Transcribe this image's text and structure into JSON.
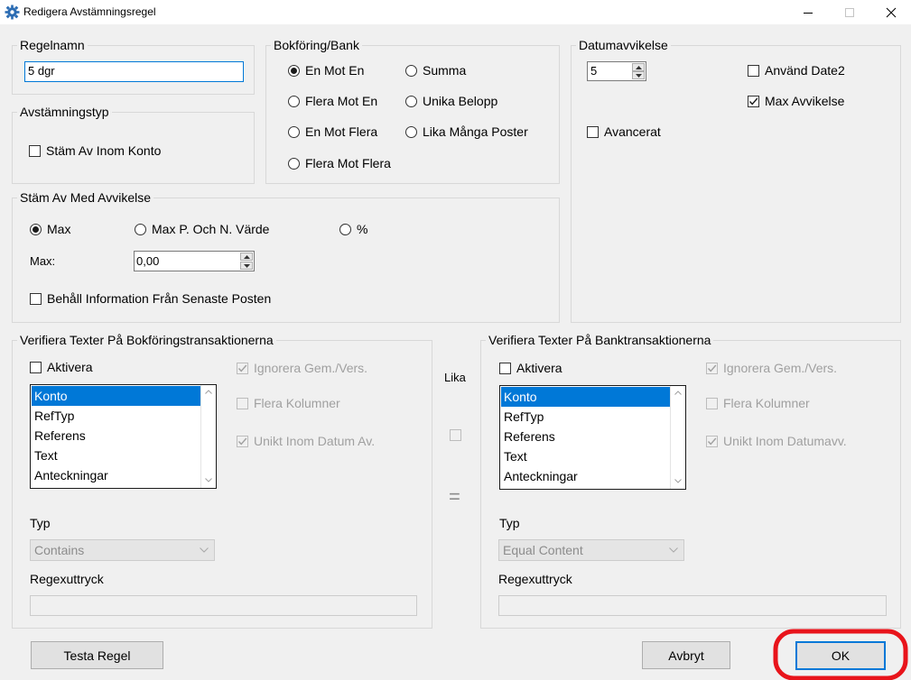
{
  "window": {
    "title": "Redigera Avstämningsregel",
    "icon": "gear-icon",
    "controls": [
      "minimize-icon",
      "maximize-icon",
      "close-icon"
    ]
  },
  "regelnamn": {
    "label": "Regelnamn",
    "value": "5 dgr"
  },
  "avstamningstyp": {
    "label": "Avstämningstyp",
    "checkbox_label": "Stäm Av Inom Konto",
    "checked": false
  },
  "bokforing_bank": {
    "label": "Bokföring/Bank",
    "options": [
      "En Mot En",
      "Summa",
      "Flera Mot En",
      "Unika Belopp",
      "En Mot Flera",
      "Lika Många Poster",
      "Flera Mot Flera"
    ],
    "selected": "En Mot En"
  },
  "datumavvikelse": {
    "label": "Datumavvikelse",
    "value": "5",
    "anvand_date2_label": "Använd Date2",
    "anvand_date2_checked": false,
    "max_avvikelse_label": "Max Avvikelse",
    "max_avvikelse_checked": true,
    "avancerat_label": "Avancerat",
    "avancerat_checked": false
  },
  "avvikelse": {
    "label": "Stäm Av Med Avvikelse",
    "options": [
      "Max",
      "Max P. Och N. Värde",
      "%"
    ],
    "selected": "Max",
    "max_label": "Max:",
    "max_value": "0,00",
    "behall_label": "Behåll Information Från Senaste Posten",
    "behall_checked": false
  },
  "bokforing_verify": {
    "label": "Verifiera Texter På Bokföringstransaktionerna",
    "aktivera_label": "Aktivera",
    "aktivera_checked": false,
    "list": [
      "Konto",
      "RefTyp",
      "Referens",
      "Text",
      "Anteckningar"
    ],
    "selected_item": "Konto",
    "ignorera_label": "Ignorera Gem./Vers.",
    "flera_label": "Flera Kolumner",
    "unikt_label": "Unikt Inom Datum Av.",
    "typ_label": "Typ",
    "typ_value": "Contains",
    "regex_label": "Regexuttryck",
    "regex_value": ""
  },
  "lika": {
    "label": "Lika",
    "equals": "="
  },
  "bank_verify": {
    "label": "Verifiera Texter På Banktransaktionerna",
    "aktivera_label": "Aktivera",
    "aktivera_checked": false,
    "list": [
      "Konto",
      "RefTyp",
      "Referens",
      "Text",
      "Anteckningar"
    ],
    "selected_item": "Konto",
    "ignorera_label": "Ignorera Gem./Vers.",
    "flera_label": "Flera Kolumner",
    "unikt_label": "Unikt Inom Datumavv.",
    "typ_label": "Typ",
    "typ_value": "Equal Content",
    "regex_label": "Regexuttryck",
    "regex_value": ""
  },
  "buttons": {
    "testa": "Testa Regel",
    "avbryt": "Avbryt",
    "ok": "OK"
  },
  "colors": {
    "accent": "#0078d7",
    "highlight_ring": "#e8141b"
  }
}
